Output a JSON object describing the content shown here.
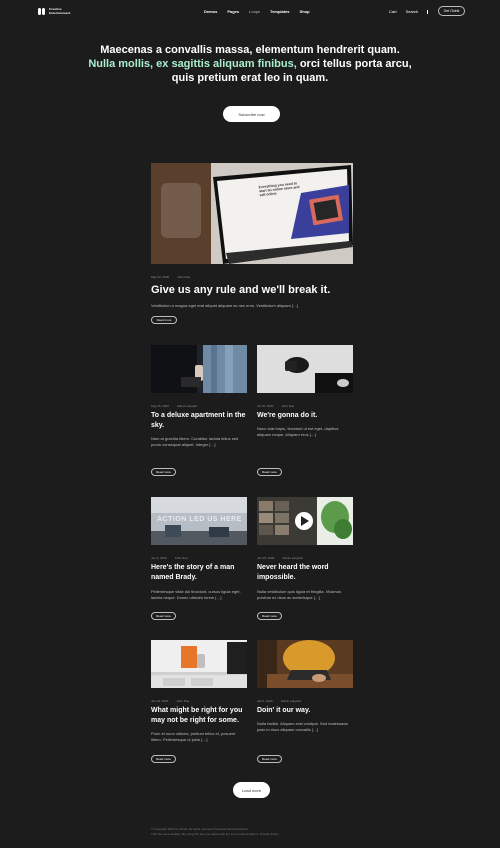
{
  "header": {
    "logo_text_1": "Creative",
    "logo_text_2": "Entertainment",
    "nav": [
      "Demos",
      "Pages",
      "Loops",
      "Templates",
      "Shop"
    ],
    "cart": "Cart",
    "search": "Search",
    "get_button": "Get Onirik"
  },
  "hero": {
    "text_white": "Maecenas a convallis massa, elementum hendrerit quam.",
    "text_accent": "Nulla mollis, ex sagittis aliquam finibus,",
    "text_white_2": "orci tellus porta arcu, quis pretium erat leo in quam.",
    "subscribe_label": "Subscribe now",
    "accent_color": "#a9efcf"
  },
  "featured": {
    "date": "May 22, 2020",
    "author": "John Doe",
    "title": "Give us any rule and we'll break it.",
    "excerpt": "Vestibulum a magna eget erat aliquet aliquam ac nec eros. Vestibulum aliquam […]",
    "read_more": "Read more",
    "laptop_text": "Everything you need to start an online store and sell online"
  },
  "posts": [
    {
      "date": "Aug 15, 2020",
      "author": "Admin Lanyard",
      "title": "To a deluxe apartment in the sky.",
      "excerpt": "Nam at gravida libero. Curabitur lacinia tellus sed purus consequat aliquet. Integer […]",
      "read_more": "Read more"
    },
    {
      "date": "Jul 16, 2020",
      "author": "John Doe",
      "title": "We're gonna do it.",
      "excerpt": "Nunc erat turpis, tincidunt ut est eget, dapibus aliquam neque. Aliquam eros […]",
      "read_more": "Read more"
    },
    {
      "date": "Jun 4, 2020",
      "author": "John Doe",
      "title": "Here's the story of a man named Brady.",
      "excerpt": "Pellentesque vitae dui tincidunt, cursus ligula eget, lacinia neque. Donec ultricies lorem […]",
      "read_more": "Read more",
      "image_text": "ACTION LED US HERE"
    },
    {
      "date": "Jan 25, 2020",
      "author": "Admin Lanyard",
      "title": "Never heard the word impossible.",
      "excerpt": "Nulla vestibulum quis ligula et fringilla. Vivamus pulvinar ex risus ac scelerisque […]",
      "read_more": "Read more"
    },
    {
      "date": "Jan 24, 2020",
      "author": "John Doe",
      "title": "What might be right for you may not be right for some.",
      "excerpt": "Proin et nunc ultrices, pretium tellus et, posuere libero. Pellentesque ut justo […]",
      "read_more": "Read more"
    },
    {
      "date": "Jan 5, 2020",
      "author": "Admin Lanyard",
      "title": "Doin' it our way.",
      "excerpt": "Nulla facilisi. Aliquam erat volutpat. Sed malesuada justo in risus aliquam convallis […]",
      "read_more": "Read more"
    }
  ],
  "load_more": "Load more",
  "footer": {
    "line1": "© Copyright 2020 by Onirik. All rights reserved. Designed and developed.",
    "line2": "This site uses cookies. By using this site you agree with the terms and conditions. Privacy Policy"
  }
}
